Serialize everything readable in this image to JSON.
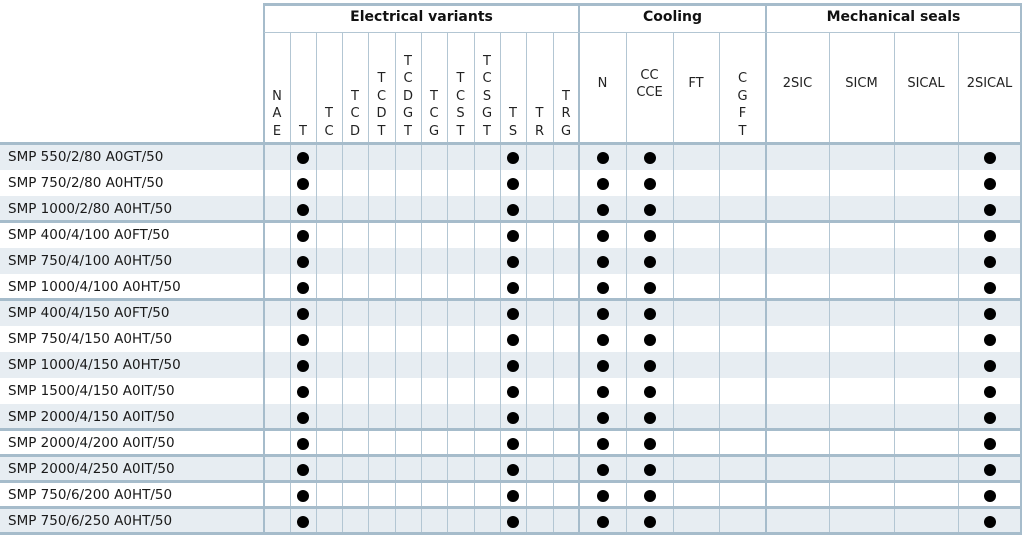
{
  "table": {
    "groups": [
      {
        "title": "Electrical variants",
        "columns": [
          "NAE",
          "T",
          "TC",
          "TCD",
          "TCDT",
          "TCDGT",
          "TCG",
          "TCST",
          "TCSGT",
          "TS",
          "TR",
          "TRG"
        ]
      },
      {
        "title": "Cooling",
        "columns": [
          "N",
          "CC CCE",
          "FT",
          "CGFT"
        ]
      },
      {
        "title": "Mechanical seals",
        "columns": [
          "2SIC",
          "SICM",
          "SICAL",
          "2SICAL"
        ]
      }
    ],
    "column_labels": [
      {
        "key": "NAE",
        "lines": [
          "N",
          "A",
          "E"
        ],
        "vertical": true
      },
      {
        "key": "T",
        "lines": [
          "T"
        ],
        "vertical": true
      },
      {
        "key": "TC",
        "lines": [
          "T",
          "C"
        ],
        "vertical": true
      },
      {
        "key": "TCD",
        "lines": [
          "T",
          "C",
          "D"
        ],
        "vertical": true
      },
      {
        "key": "TCDT",
        "lines": [
          "T",
          "C",
          "D",
          "T"
        ],
        "vertical": true
      },
      {
        "key": "TCDGT",
        "lines": [
          "T",
          "C",
          "D",
          "G",
          "T"
        ],
        "vertical": true
      },
      {
        "key": "TCG",
        "lines": [
          "T",
          "C",
          "G"
        ],
        "vertical": true
      },
      {
        "key": "TCST",
        "lines": [
          "T",
          "C",
          "S",
          "T"
        ],
        "vertical": true
      },
      {
        "key": "TCSGT",
        "lines": [
          "T",
          "C",
          "S",
          "G",
          "T"
        ],
        "vertical": true
      },
      {
        "key": "TS",
        "lines": [
          "T",
          "S"
        ],
        "vertical": true
      },
      {
        "key": "TR",
        "lines": [
          "T",
          "R"
        ],
        "vertical": true
      },
      {
        "key": "TRG",
        "lines": [
          "T",
          "R",
          "G"
        ],
        "vertical": true
      },
      {
        "key": "N",
        "lines": [
          "N"
        ],
        "vertical": false
      },
      {
        "key": "CC CCE",
        "lines": [
          "CC",
          "CCE"
        ],
        "vertical": false
      },
      {
        "key": "FT",
        "lines": [
          "FT"
        ],
        "vertical": false
      },
      {
        "key": "CGFT",
        "lines": [
          "C",
          "G",
          "F",
          "T"
        ],
        "vertical": true
      },
      {
        "key": "2SIC",
        "lines": [
          "2SIC"
        ],
        "vertical": false
      },
      {
        "key": "SICM",
        "lines": [
          "SICM"
        ],
        "vertical": false
      },
      {
        "key": "SICAL",
        "lines": [
          "SICAL"
        ],
        "vertical": false
      },
      {
        "key": "2SICAL",
        "lines": [
          "2SICAL"
        ],
        "vertical": false
      }
    ],
    "rows": [
      {
        "model": "SMP 550/2/80 A0GT/50",
        "marks": [
          "T",
          "TS",
          "N",
          "CC CCE",
          "2SICAL"
        ]
      },
      {
        "model": "SMP 750/2/80 A0HT/50",
        "marks": [
          "T",
          "TS",
          "N",
          "CC CCE",
          "2SICAL"
        ]
      },
      {
        "model": "SMP 1000/2/80 A0HT/50",
        "marks": [
          "T",
          "TS",
          "N",
          "CC CCE",
          "2SICAL"
        ]
      },
      {
        "model": "SMP 400/4/100 A0FT/50",
        "marks": [
          "T",
          "TS",
          "N",
          "CC CCE",
          "2SICAL"
        ]
      },
      {
        "model": "SMP 750/4/100 A0HT/50",
        "marks": [
          "T",
          "TS",
          "N",
          "CC CCE",
          "2SICAL"
        ]
      },
      {
        "model": "SMP 1000/4/100 A0HT/50",
        "marks": [
          "T",
          "TS",
          "N",
          "CC CCE",
          "2SICAL"
        ]
      },
      {
        "model": "SMP 400/4/150 A0FT/50",
        "marks": [
          "T",
          "TS",
          "N",
          "CC CCE",
          "2SICAL"
        ]
      },
      {
        "model": "SMP 750/4/150 A0HT/50",
        "marks": [
          "T",
          "TS",
          "N",
          "CC CCE",
          "2SICAL"
        ]
      },
      {
        "model": "SMP 1000/4/150 A0HT/50",
        "marks": [
          "T",
          "TS",
          "N",
          "CC CCE",
          "2SICAL"
        ]
      },
      {
        "model": "SMP 1500/4/150 A0IT/50",
        "marks": [
          "T",
          "TS",
          "N",
          "CC CCE",
          "2SICAL"
        ]
      },
      {
        "model": "SMP 2000/4/150 A0IT/50",
        "marks": [
          "T",
          "TS",
          "N",
          "CC CCE",
          "2SICAL"
        ]
      },
      {
        "model": "SMP 2000/4/200 A0IT/50",
        "marks": [
          "T",
          "TS",
          "N",
          "CC CCE",
          "2SICAL"
        ]
      },
      {
        "model": "SMP 2000/4/250 A0IT/50",
        "marks": [
          "T",
          "TS",
          "N",
          "CC CCE",
          "2SICAL"
        ]
      },
      {
        "model": "SMP 750/6/200 A0HT/50",
        "marks": [
          "T",
          "TS",
          "N",
          "CC CCE",
          "2SICAL"
        ]
      },
      {
        "model": "SMP 750/6/250 A0HT/50",
        "marks": [
          "T",
          "TS",
          "N",
          "CC CCE",
          "2SICAL"
        ]
      }
    ],
    "row_group_ends": [
      3,
      6,
      11,
      12,
      13,
      14,
      15
    ],
    "mark_symbol": "●",
    "colors": {
      "row_shade": "#e7edf2",
      "grid_line": "#b3c6d3",
      "mark": "#000000"
    }
  }
}
